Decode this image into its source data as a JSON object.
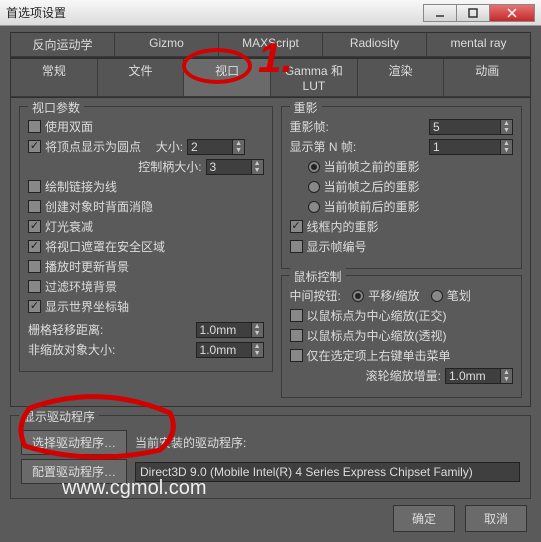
{
  "window": {
    "title": "首选项设置"
  },
  "tabs": {
    "row1": [
      "反向运动学",
      "Gizmo",
      "MAXScript",
      "Radiosity",
      "mental ray"
    ],
    "row2": [
      "常规",
      "文件",
      "视口",
      "Gamma 和 LUT",
      "渲染",
      "动画"
    ]
  },
  "viewport": {
    "legend": "视口参数",
    "use_dual": "使用双面",
    "vert_dot": "将顶点显示为圆点",
    "size_lbl": "大小:",
    "size_val": "2",
    "handle_lbl": "控制柄大小:",
    "handle_val": "3",
    "draw_links": "绘制链接为线",
    "backface": "创建对象时背面消隐",
    "atten": "灯光衰减",
    "mask_safe": "将视口遮罩在安全区域",
    "play_bg": "播放时更新背景",
    "filter_bg": "过滤环境背景",
    "world_axis": "显示世界坐标轴",
    "grid_lbl": "栅格轻移距离:",
    "grid_val": "1.0mm",
    "nonscale_lbl": "非缩放对象大小:",
    "nonscale_val": "1.0mm"
  },
  "replay": {
    "legend": "重影",
    "frames_lbl": "重影帧:",
    "frames_val": "5",
    "nth_lbl": "显示第 N 帧:",
    "nth_val": "1",
    "before": "当前帧之前的重影",
    "after": "当前帧之后的重影",
    "both": "当前帧前后的重影",
    "wire": "线框内的重影",
    "shownum": "显示帧编号"
  },
  "mouse": {
    "legend": "鼠标控制",
    "mid_lbl": "中间按钮:",
    "pan": "平移/缩放",
    "stroke": "笔划",
    "center_ortho": "以鼠标点为中心缩放(正交)",
    "center_persp": "以鼠标点为中心缩放(透视)",
    "rclick_menu": "仅在选定项上右键单击菜单",
    "wheel_lbl": "滚轮缩放增量:",
    "wheel_val": "1.0mm"
  },
  "driver": {
    "legend": "显示驱动程序",
    "select_btn": "选择驱动程序…",
    "installed_lbl": "当前安装的驱动程序:",
    "config_btn": "配置驱动程序…",
    "current": "Direct3D 9.0 (Mobile Intel(R) 4 Series Express Chipset Family)"
  },
  "footer": {
    "ok": "确定",
    "cancel": "取消"
  },
  "watermark": "www.cgmol.com",
  "anno": {
    "one": "1."
  }
}
